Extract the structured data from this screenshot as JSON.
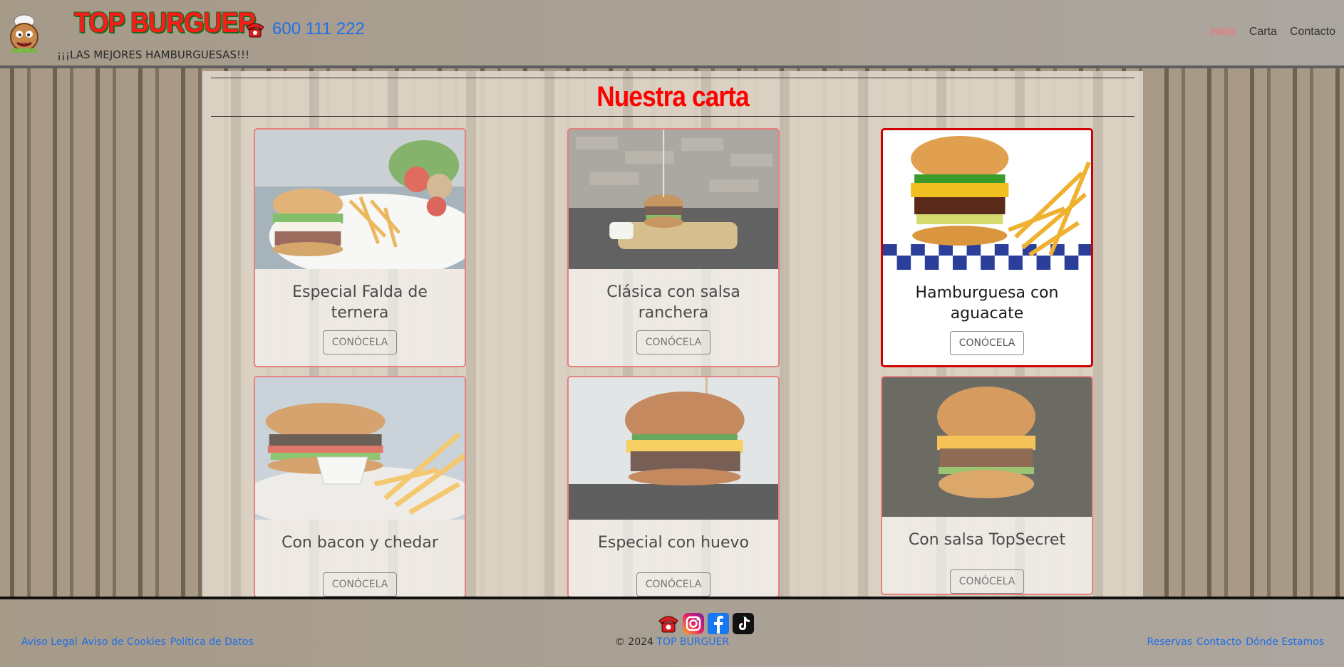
{
  "header": {
    "brand": "TOP BURGUER",
    "phone": "600 111 222",
    "tagline": "¡¡¡LAS MEJORES HAMBURGUESAS!!!",
    "nav": [
      {
        "label": "Inicio",
        "active": true
      },
      {
        "label": "Carta",
        "active": false
      },
      {
        "label": "Contacto",
        "active": false
      }
    ]
  },
  "main": {
    "title": "Nuestra carta",
    "cards": [
      {
        "title": "Especial Falda de ternera",
        "button": "CONÓCELA"
      },
      {
        "title": "Clásica con salsa ranchera",
        "button": "CONÓCELA"
      },
      {
        "title": "Hamburguesa con aguacate",
        "button": "CONÓCELA"
      },
      {
        "title": "Con bacon y chedar",
        "button": "CONÓCELA"
      },
      {
        "title": "Especial con huevo",
        "button": "CONÓCELA"
      },
      {
        "title": "Con salsa TopSecret",
        "button": "CONÓCELA"
      }
    ]
  },
  "footer": {
    "left_links": [
      "Aviso Legal",
      "Aviso de Cookies",
      "Política de Datos"
    ],
    "copyright_prefix": "© 2024",
    "copyright_link": "TOP BURGUER",
    "right_links": [
      "Reservas",
      "Contacto",
      "Dónde Estamos"
    ],
    "social_icons": [
      "phone-icon",
      "instagram-icon",
      "facebook-icon",
      "tiktok-icon"
    ]
  },
  "colors": {
    "brand_red": "#ff1a1a",
    "link_blue": "#1f6fe8",
    "active_nav": "#ff6b6b",
    "card_highlight_border": "#d00000"
  }
}
